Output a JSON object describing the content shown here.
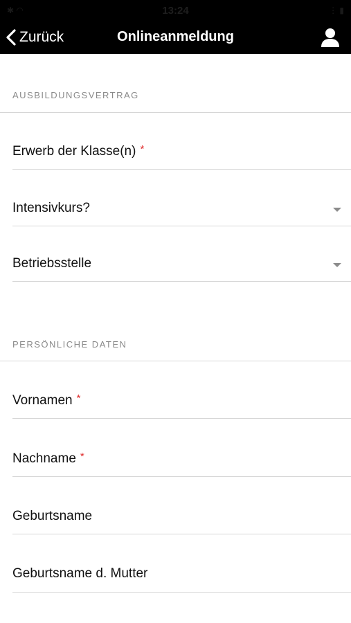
{
  "status_bar": {
    "time": "13:24",
    "left": "✱ ◠",
    "right": "⋮ ▮"
  },
  "nav": {
    "back_label": "Zurück",
    "title": "Onlineanmeldung"
  },
  "sections": {
    "training_contract": {
      "header": "AUSBILDUNGSVERTRAG",
      "fields": [
        {
          "label": "Erwerb der Klasse(n)",
          "required_mark": "*"
        },
        {
          "label": "Intensivkurs?"
        },
        {
          "label": "Betriebsstelle"
        }
      ]
    },
    "personal_data": {
      "header": "PERSÖNLICHE DATEN",
      "fields": [
        {
          "label": "Vornamen",
          "required_mark": "*"
        },
        {
          "label": "Nachname",
          "required_mark": "*"
        },
        {
          "label": "Geburtsname"
        },
        {
          "label": "Geburtsname d. Mutter"
        }
      ]
    }
  },
  "colors": {
    "nav_bg": "#000000",
    "required": "#e03030",
    "section_header": "#8a8a8a",
    "divider": "#d6d6d6"
  },
  "icons": {
    "back": "chevron-left-icon",
    "user": "user-icon",
    "dropdown": "dropdown-caret-icon"
  }
}
